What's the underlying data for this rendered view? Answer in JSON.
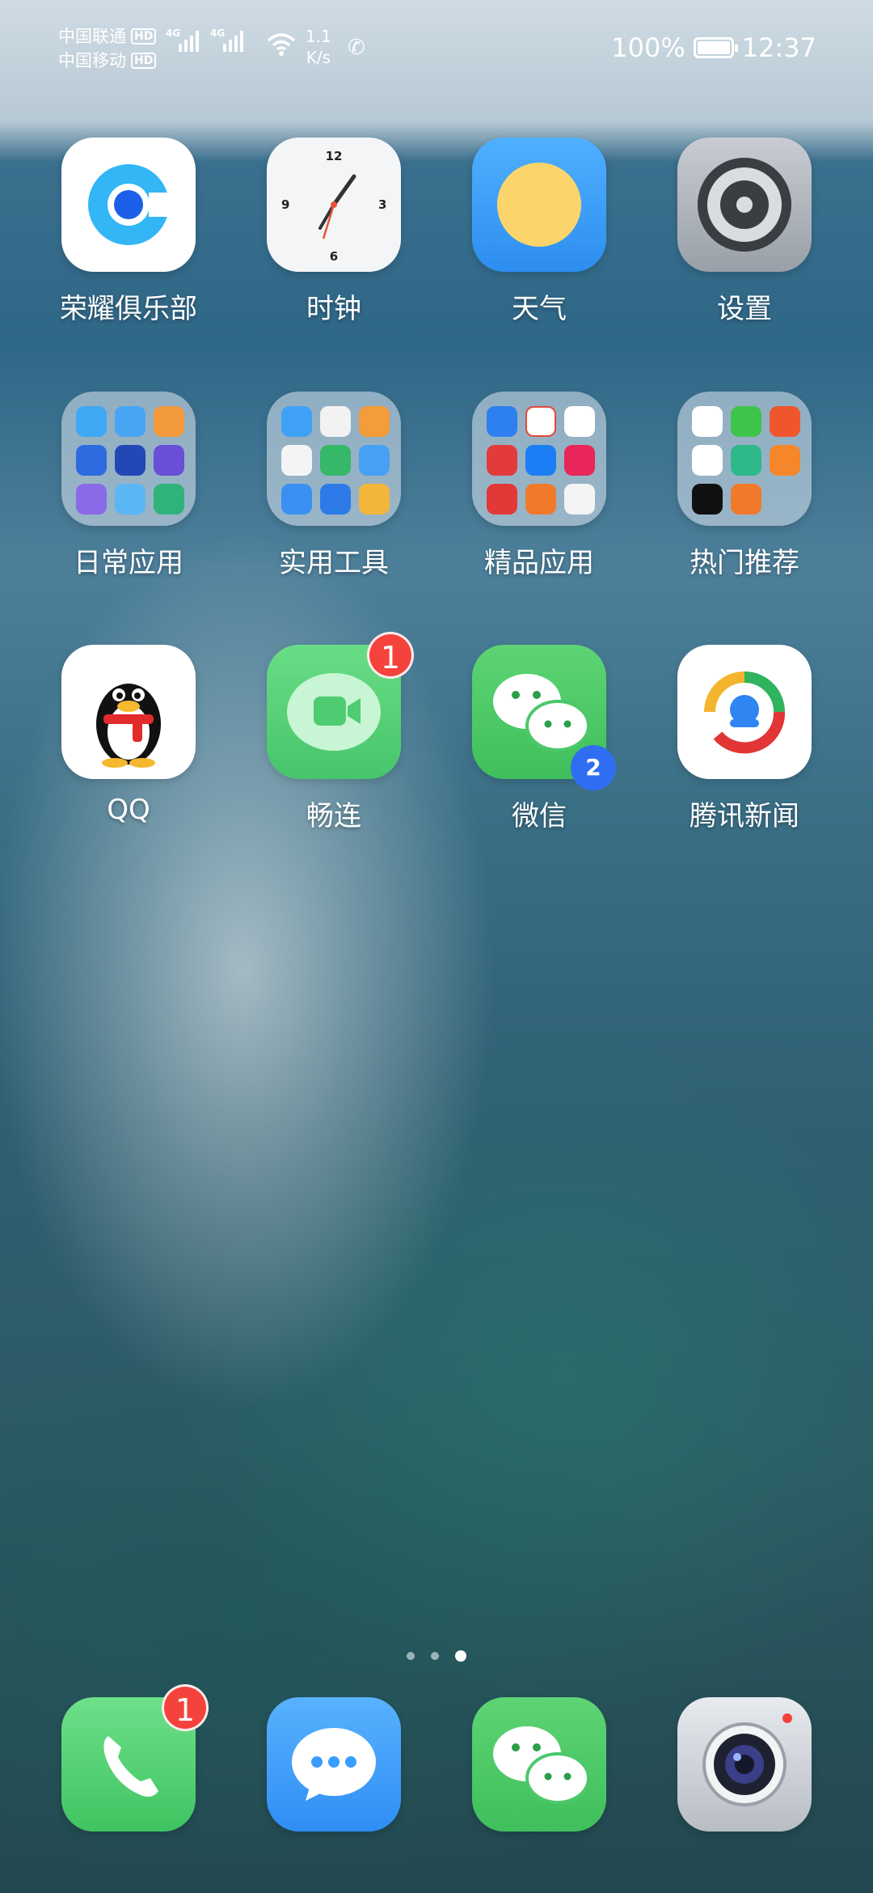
{
  "status_bar": {
    "carrier1": "中国联通",
    "carrier2": "中国移动",
    "hd": "HD",
    "net1": "4G",
    "net2": "4G",
    "speed_value": "1.1",
    "speed_unit": "K/s",
    "battery_text": "100%",
    "battery_level": 1.0,
    "time": "12:37"
  },
  "apps": {
    "honor_club": "荣耀俱乐部",
    "clock": "时钟",
    "weather": "天气",
    "settings": "设置",
    "daily_apps": "日常应用",
    "utility_tools": "实用工具",
    "premium_apps": "精品应用",
    "hot_picks": "热门推荐",
    "qq": "QQ",
    "changlian": "畅连",
    "wechat": "微信",
    "tencent_news": "腾讯新闻"
  },
  "clock_face": {
    "n12": "12",
    "n3": "3",
    "n6": "6",
    "n9": "9"
  },
  "badges": {
    "changlian": "1",
    "phone": "1",
    "wechat_clone": "2"
  },
  "page_indicator": {
    "count": 3,
    "active_index": 2
  },
  "colors": {
    "badge_red": "#f4433c",
    "green": "#5ed474",
    "blue": "#3a9cff"
  }
}
